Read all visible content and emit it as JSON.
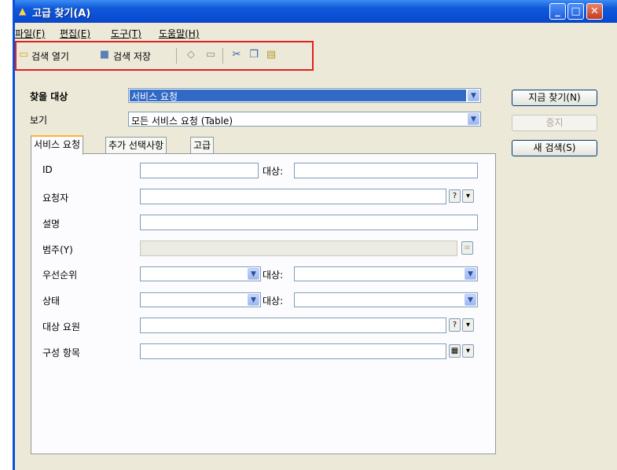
{
  "window": {
    "title": "고급 찾기(A)",
    "min": "_",
    "max": "□",
    "close": "✕"
  },
  "menu": [
    "파일(F)",
    "편집(E)",
    "도구(T)",
    "도움말(H)"
  ],
  "toolbar": {
    "open_label": "검색 열기",
    "save_label": "검색 저장"
  },
  "search": {
    "target_label": "찾을 대상",
    "target_value": "서비스 요청",
    "view_label": "보기",
    "view_value": "모든 서비스 요청 (Table)"
  },
  "buttons": {
    "find_now": "지금 찾기(N)",
    "stop": "중지",
    "new_search": "새 검색(S)"
  },
  "tabs": [
    "서비스 요청",
    "추가 선택사항",
    "고급"
  ],
  "form": {
    "id": "ID",
    "target": "대상:",
    "requester": "요청자",
    "description": "설명",
    "category": "범주(Y)",
    "priority": "우선순위",
    "status": "상태",
    "assigned": "대상 요원",
    "config_item": "구성 항목"
  }
}
